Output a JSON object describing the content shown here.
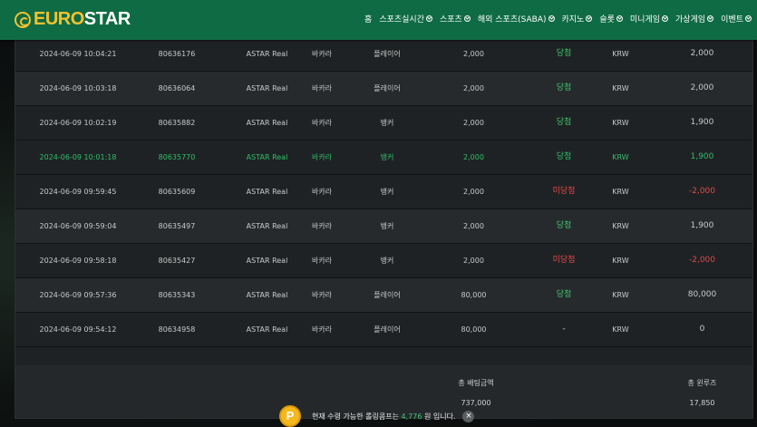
{
  "header": {
    "logo_main": "EURO",
    "logo_accent": "STAR",
    "nav": [
      {
        "label": "홈",
        "has_chevron": false
      },
      {
        "label": "스포츠실시간",
        "has_chevron": true
      },
      {
        "label": "스포츠",
        "has_chevron": true
      },
      {
        "label": "해외 스포츠(SABA)",
        "has_chevron": true
      },
      {
        "label": "카지노",
        "has_chevron": true
      },
      {
        "label": "슬롯",
        "has_chevron": true
      },
      {
        "label": "미니게임",
        "has_chevron": true
      },
      {
        "label": "가상게임",
        "has_chevron": true
      },
      {
        "label": "이벤트",
        "has_chevron": true
      }
    ]
  },
  "bets": [
    {
      "date": "2024-06-09 10:04:21",
      "id": "80636176",
      "game": "ASTAR Real",
      "type": "바카라",
      "bet": "플레이어",
      "amount": "2,000",
      "result": "당첨",
      "currency": "KRW",
      "payout": "2,000"
    },
    {
      "date": "2024-06-09 10:03:18",
      "id": "80636064",
      "game": "ASTAR Real",
      "type": "바카라",
      "bet": "플레이어",
      "amount": "2,000",
      "result": "당첨",
      "currency": "KRW",
      "payout": "2,000"
    },
    {
      "date": "2024-06-09 10:02:19",
      "id": "80635882",
      "game": "ASTAR Real",
      "type": "바카라",
      "bet": "뱅커",
      "amount": "2,000",
      "result": "당첨",
      "currency": "KRW",
      "payout": "1,900"
    },
    {
      "date": "2024-06-09 10:01:18",
      "id": "80635770",
      "game": "ASTAR Real",
      "type": "바카라",
      "bet": "뱅커",
      "amount": "2,000",
      "result": "당첨",
      "currency": "KRW",
      "payout": "1,900"
    },
    {
      "date": "2024-06-09 09:59:45",
      "id": "80635609",
      "game": "ASTAR Real",
      "type": "바카라",
      "bet": "뱅커",
      "amount": "2,000",
      "result": "미당첨",
      "currency": "KRW",
      "payout": "-2,000"
    },
    {
      "date": "2024-06-09 09:59:04",
      "id": "80635497",
      "game": "ASTAR Real",
      "type": "바카라",
      "bet": "뱅커",
      "amount": "2,000",
      "result": "당첨",
      "currency": "KRW",
      "payout": "1,900"
    },
    {
      "date": "2024-06-09 09:58:18",
      "id": "80635427",
      "game": "ASTAR Real",
      "type": "바카라",
      "bet": "뱅커",
      "amount": "2,000",
      "result": "미당첨",
      "currency": "KRW",
      "payout": "-2,000"
    },
    {
      "date": "2024-06-09 09:57:36",
      "id": "80635343",
      "game": "ASTAR Real",
      "type": "바카라",
      "bet": "플레이어",
      "amount": "80,000",
      "result": "당첨",
      "currency": "KRW",
      "payout": "80,000"
    },
    {
      "date": "2024-06-09 09:54:12",
      "id": "80634958",
      "game": "ASTAR Real",
      "type": "바카라",
      "bet": "플레이어",
      "amount": "80,000",
      "result": "-",
      "currency": "KRW",
      "payout": "0"
    }
  ],
  "totals": {
    "bet_label": "총 배팅금액",
    "bet_value": "737,000",
    "win_label": "총 윈루즈",
    "win_value": "17,850"
  },
  "toast": {
    "coin_letter": "P",
    "prefix": "현재 수령 가능한 롤링콤프는",
    "points": "4,776",
    "suffix": "원 입니다.",
    "close": "×"
  }
}
